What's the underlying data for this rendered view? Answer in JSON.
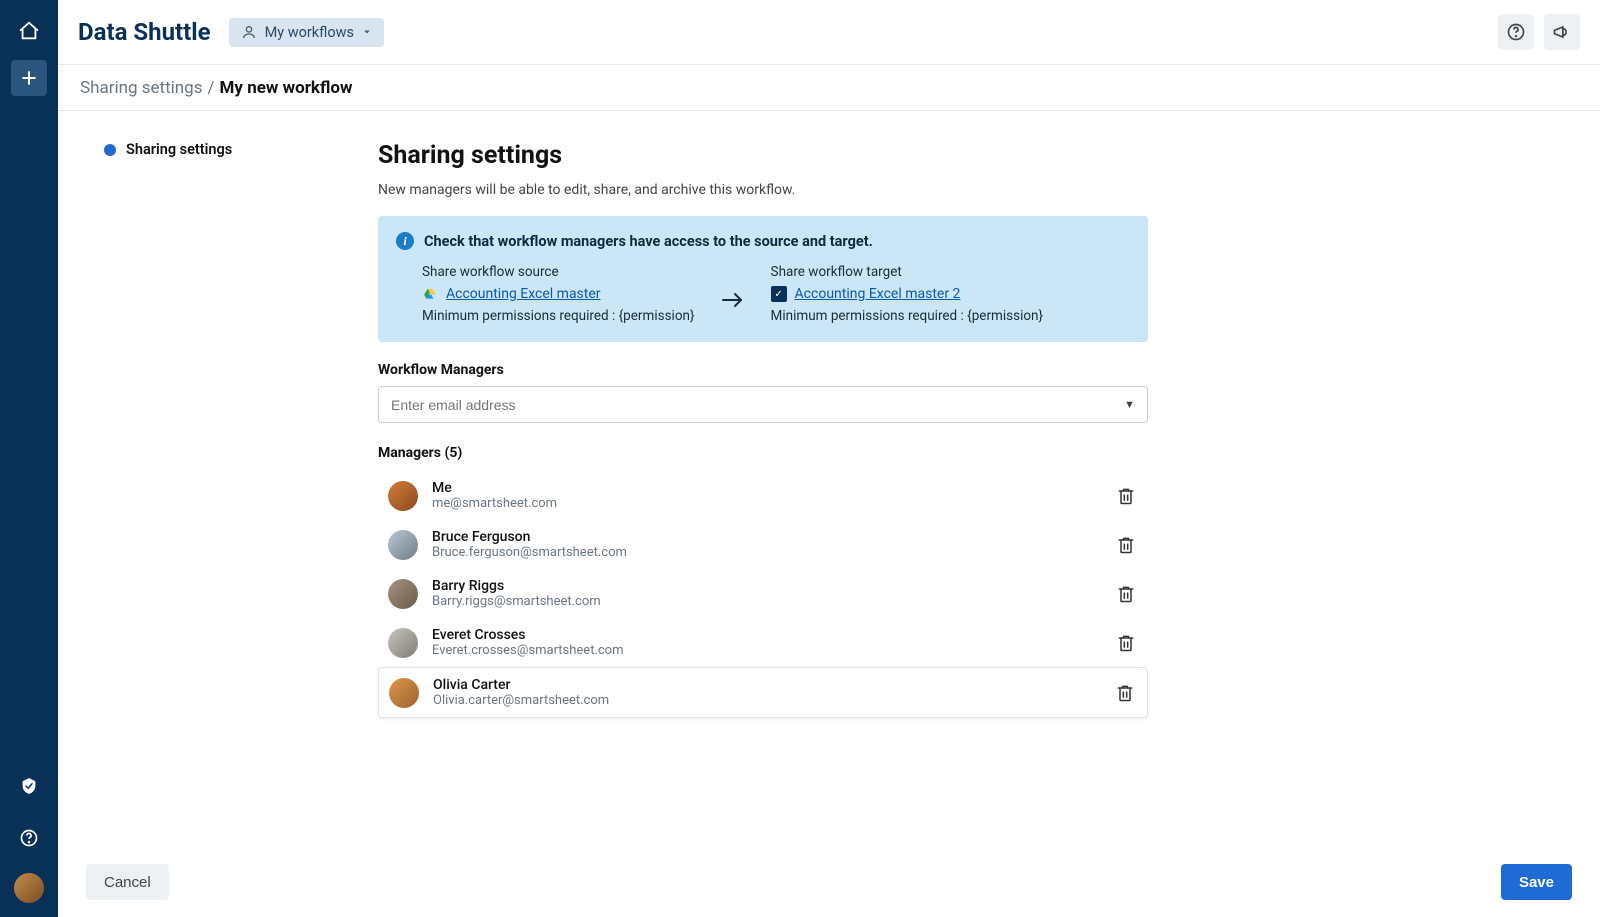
{
  "brand": "Data Shuttle",
  "pill": {
    "label": "My workflows"
  },
  "breadcrumb": {
    "parent": "Sharing settings",
    "sep": "/",
    "current": "My new workflow"
  },
  "sidenav": {
    "item": "Sharing settings"
  },
  "page": {
    "title": "Sharing settings",
    "subtitle": "New managers will be able to edit, share, and archive this workflow."
  },
  "info": {
    "heading": "Check that workflow managers have access to the source and target.",
    "source": {
      "label": "Share workflow source",
      "link": "Accounting Excel master",
      "perm": "Minimum permissions required : {permission}"
    },
    "target": {
      "label": "Share workflow target",
      "link": "Accounting Excel master 2",
      "perm": "Minimum permissions required : {permission}"
    }
  },
  "managers_section": {
    "label": "Workflow Managers",
    "placeholder": "Enter email address",
    "list_label": "Managers (5)"
  },
  "managers": [
    {
      "name": "Me",
      "email": "me@smartsheet.com"
    },
    {
      "name": "Bruce Ferguson",
      "email": "Bruce.ferguson@smartsheet.com"
    },
    {
      "name": "Barry Riggs",
      "email": "Barry.riggs@smartsheet.com"
    },
    {
      "name": "Everet Crosses",
      "email": "Everet.crosses@smartsheet.com"
    },
    {
      "name": "Olivia Carter",
      "email": "Olivia.carter@smartsheet.com"
    }
  ],
  "footer": {
    "cancel": "Cancel",
    "save": "Save"
  }
}
